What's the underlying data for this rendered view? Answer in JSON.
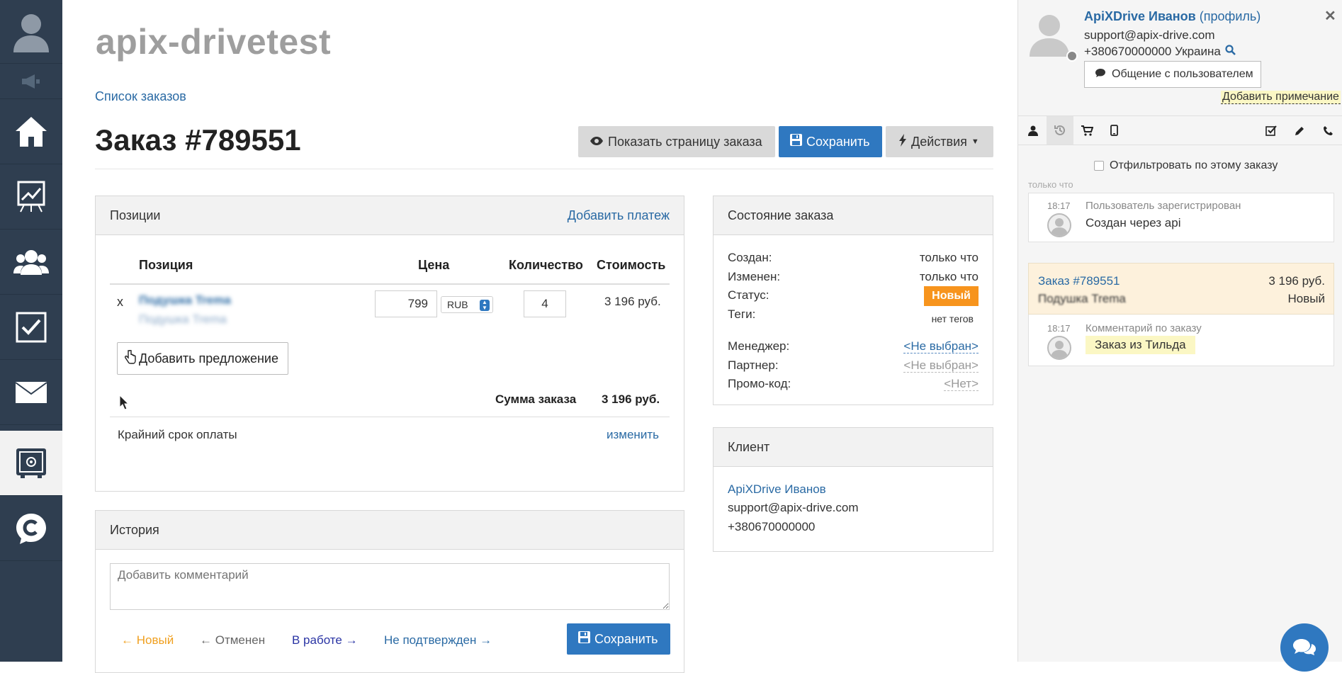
{
  "main": {
    "site_title": "apix-drivetest",
    "breadcrumb": "Список заказов",
    "order_title": "Заказ #789551",
    "buttons": {
      "show_page": "Показать страницу заказа",
      "save": "Сохранить",
      "actions": "Действия"
    }
  },
  "positions": {
    "title": "Позиции",
    "add_payment": "Добавить платеж",
    "headers": {
      "position": "Позиция",
      "price": "Цена",
      "qty": "Количество",
      "cost": "Стоимость"
    },
    "row": {
      "remove": "x",
      "name": "Подушка Trema",
      "sub": "Подушка Trema",
      "price": "799",
      "currency": "RUB",
      "qty": "4",
      "cost": "3 196 руб."
    },
    "add_offer": "Добавить предложение",
    "total_label": "Сумма заказа",
    "total_value": "3 196 руб.",
    "deadline_label": "Крайний срок оплаты",
    "change": "изменить"
  },
  "history": {
    "title": "История",
    "comment_placeholder": "Добавить комментарий",
    "status_new": "Новый",
    "status_cancelled": "Отменен",
    "status_inwork": "В работе",
    "status_unconfirmed": "Не подтвержден",
    "save": "Сохранить"
  },
  "state": {
    "title": "Состояние заказа",
    "created_label": "Создан:",
    "created_value": "только что",
    "changed_label": "Изменен:",
    "changed_value": "только что",
    "status_label": "Статус:",
    "status_value": "Новый",
    "tags_label": "Теги:",
    "tags_value": "нет тегов",
    "manager_label": "Менеджер:",
    "manager_value": "<Не выбран>",
    "partner_label": "Партнер:",
    "partner_value": "<Не выбран>",
    "promo_label": "Промо-код:",
    "promo_value": "<Нет>"
  },
  "client": {
    "title": "Клиент",
    "name": "ApiXDrive Иванов",
    "email": "support@apix-drive.com",
    "phone": "+380670000000"
  },
  "right": {
    "user_name": "ApiXDrive Иванов",
    "profile_link": "(профиль)",
    "email": "support@apix-drive.com",
    "phone": "+380670000000 Украина",
    "chat_btn": "Общение с пользователем",
    "add_note": "Добавить примечание",
    "filter_label": "Отфильтровать по этому заказу",
    "time_group": "только что",
    "feed1": {
      "time": "18:17",
      "title": "Пользователь зарегистрирован",
      "text": "Создан через api"
    },
    "order_card": {
      "title": "Заказ #789551",
      "amount": "3 196 руб.",
      "item": "Подушка Trema",
      "status": "Новый"
    },
    "feed2": {
      "time": "18:17",
      "title": "Комментарий по заказу",
      "text": "Заказ из Тильда"
    }
  },
  "colors": {
    "sidebar": "#2f3e50",
    "accent_blue": "#2f78c0",
    "link": "#2a6aa4",
    "status_new": "#f7941d",
    "order_card_bg": "#fdf1dc"
  },
  "icons": [
    "user-avatar-icon",
    "megaphone-icon",
    "home-icon",
    "chart-icon",
    "users-icon",
    "checkbox-icon",
    "mail-icon",
    "safe-icon",
    "chat-logo-icon",
    "eye-icon",
    "floppy-icon",
    "bolt-icon",
    "hand-pointer-icon",
    "search-icon",
    "comment-icon",
    "close-icon",
    "history-icon",
    "cart-icon",
    "mobile-icon",
    "check-square-icon",
    "pencil-icon",
    "phone-icon",
    "chat-bubble-icon"
  ]
}
